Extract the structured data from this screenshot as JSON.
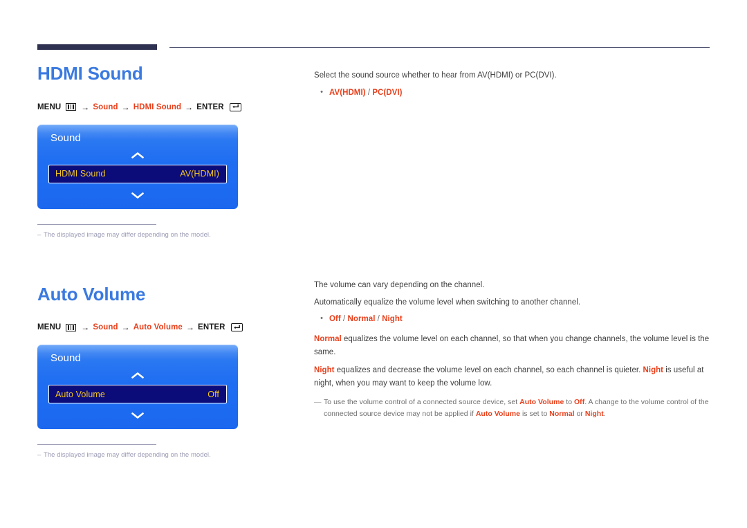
{
  "document": {
    "header_rule": {
      "thick_color": "#2e3150",
      "thin_color": "#4a4d6b"
    },
    "accent_blue": "#3a7ae0",
    "accent_red": "#e8401c",
    "osd_value_color": "#f3c620"
  },
  "sections": [
    {
      "title": "HDMI Sound",
      "menu_path": {
        "menu_label": "MENU",
        "menu_icon": "menu-bars-icon",
        "arrow": "→",
        "steps": [
          "Sound",
          "HDMI Sound"
        ],
        "enter_label": "ENTER",
        "enter_icon": "enter-return-icon"
      },
      "osd": {
        "title": "Sound",
        "up_icon": "chevron-up-icon",
        "down_icon": "chevron-down-icon",
        "row_label": "HDMI Sound",
        "row_value": "AV(HDMI)"
      },
      "image_note": {
        "dash": "–",
        "text": "The displayed image may differ depending on the model."
      },
      "body": {
        "intro": "Select the sound source whether to hear from AV(HDMI) or PC(DVI).",
        "bullet": {
          "marker": "•",
          "option1": "AV(HDMI)",
          "separator": " / ",
          "option2": "PC(DVI)"
        }
      }
    },
    {
      "title": "Auto Volume",
      "menu_path": {
        "menu_label": "MENU",
        "menu_icon": "menu-bars-icon",
        "arrow": "→",
        "steps": [
          "Sound",
          "Auto Volume"
        ],
        "enter_label": "ENTER",
        "enter_icon": "enter-return-icon"
      },
      "osd": {
        "title": "Sound",
        "up_icon": "chevron-up-icon",
        "down_icon": "chevron-down-icon",
        "row_label": "Auto Volume",
        "row_value": "Off"
      },
      "image_note": {
        "dash": "–",
        "text": "The displayed image may differ depending on the model."
      },
      "body": {
        "para1": "The volume can vary depending on the channel.",
        "para2": "Automatically equalize the volume level when switching to another channel.",
        "bullet": {
          "marker": "•",
          "option1": "Off",
          "sep1": " / ",
          "option2": "Normal",
          "sep2": " / ",
          "option3": "Night"
        },
        "para3": {
          "kw1": "Normal",
          "rest": " equalizes the volume level on each channel, so that when you change channels, the volume level is the same."
        },
        "para4": {
          "kw1": "Night",
          "mid": " equalizes and decrease the volume level on each channel, so each channel is quieter. ",
          "kw2": "Night",
          "rest": " is useful at night, when you may want to keep the volume low."
        },
        "note": {
          "emdash": "—",
          "t1": "To use the volume control of a connected source device, set ",
          "kw1": "Auto Volume",
          "t2": " to ",
          "kw2": "Off",
          "t3": ". A change to the volume control of the connected source device may not be applied if ",
          "kw3": "Auto Volume",
          "t4": " is set to ",
          "kw4": "Normal",
          "t5": " or ",
          "kw5": "Night",
          "t6": "."
        }
      }
    }
  ]
}
